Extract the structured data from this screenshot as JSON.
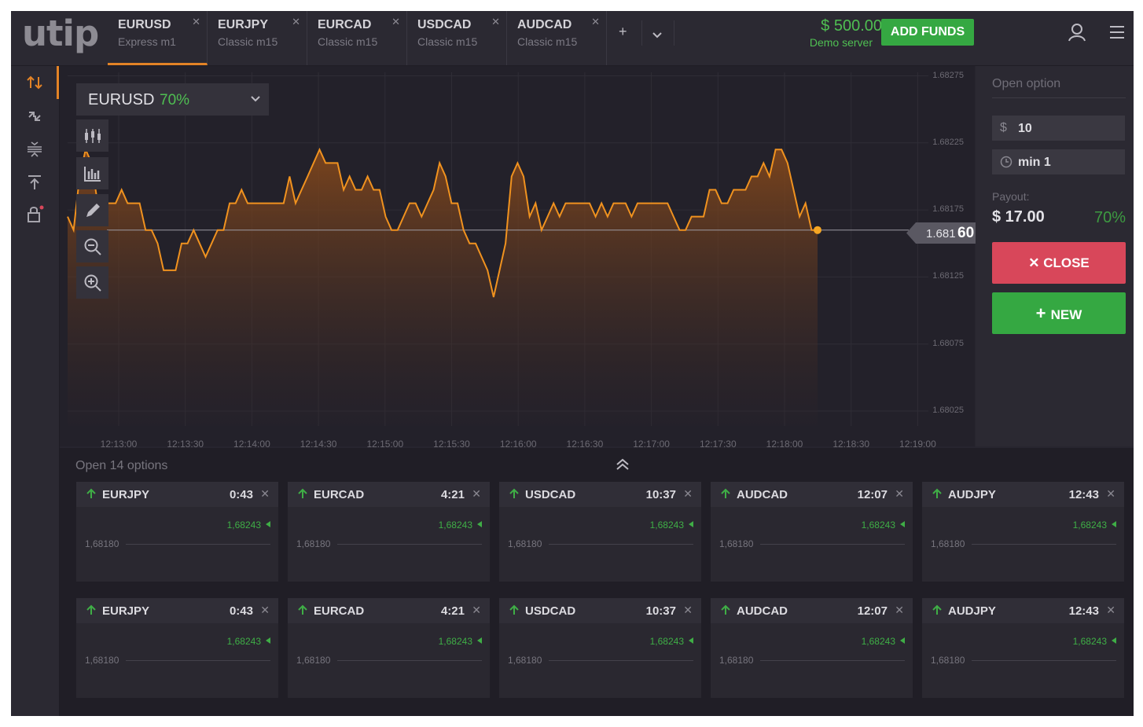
{
  "brand": {
    "logo": "utip"
  },
  "tabs": [
    {
      "symbol": "EURUSD",
      "subtitle": "Express m1",
      "active": true
    },
    {
      "symbol": "EURJPY",
      "subtitle": "Classic m15"
    },
    {
      "symbol": "EURCAD",
      "subtitle": "Classic m15"
    },
    {
      "symbol": "USDCAD",
      "subtitle": "Classic m15"
    },
    {
      "symbol": "AUDCAD",
      "subtitle": "Classic m15"
    }
  ],
  "account": {
    "balance": "$ 500.00",
    "server": "Demo server",
    "add_funds_label": "ADD FUNDS"
  },
  "chart": {
    "pair": "EURUSD",
    "payout_pct": "70%",
    "price_prefix": "1.681",
    "price_suffix": "60",
    "colors": {
      "line": "#f0921f",
      "accent_green": "#4fbf52",
      "close_red": "#d8475a"
    }
  },
  "chart_data": {
    "type": "area",
    "yticks": [
      1.68275,
      1.68225,
      1.68175,
      1.68125,
      1.68075,
      1.68025
    ],
    "yticks_text": [
      "1.68275",
      "1.68225",
      "1.68175",
      "1.68125",
      "1.68075",
      "1.68025"
    ],
    "xticks": [
      "12:13:00",
      "12:13:30",
      "12:14:00",
      "12:14:30",
      "12:15:00",
      "12:15:30",
      "12:16:00",
      "12:16:30",
      "12:17:00",
      "12:17:30",
      "12:18:00",
      "12:18:30",
      "12:19:00"
    ],
    "ylim": [
      1.68,
      1.683
    ],
    "current_price": 1.6816,
    "series": [
      {
        "values": [
          1.6817,
          1.6816,
          1.682,
          1.6822,
          1.6821,
          1.6818,
          1.6818,
          1.6818,
          1.6818,
          1.6819,
          1.6818,
          1.6818,
          1.6818,
          1.6816,
          1.6816,
          1.6815,
          1.6813,
          1.6813,
          1.6813,
          1.6815,
          1.6815,
          1.6816,
          1.6815,
          1.6814,
          1.6815,
          1.6816,
          1.6816,
          1.6818,
          1.6818,
          1.6819,
          1.6818,
          1.6818,
          1.6818,
          1.6818,
          1.6818,
          1.6818,
          1.6818,
          1.682,
          1.6818,
          1.6819,
          1.682,
          1.6821,
          1.6822,
          1.6821,
          1.6821,
          1.6821,
          1.6819,
          1.682,
          1.6819,
          1.6819,
          1.682,
          1.6819,
          1.6819,
          1.6817,
          1.6816,
          1.6816,
          1.6817,
          1.6818,
          1.6818,
          1.6817,
          1.6818,
          1.6819,
          1.6821,
          1.682,
          1.6818,
          1.6818,
          1.6816,
          1.6815,
          1.6815,
          1.6814,
          1.6813,
          1.6811,
          1.6813,
          1.6815,
          1.682,
          1.6821,
          1.682,
          1.6817,
          1.6818,
          1.6816,
          1.6817,
          1.6818,
          1.6817,
          1.6818,
          1.6818,
          1.6818,
          1.6818,
          1.6818,
          1.6817,
          1.6818,
          1.6817,
          1.6818,
          1.6818,
          1.6818,
          1.6817,
          1.6818,
          1.6818,
          1.6818,
          1.6818,
          1.6818,
          1.6818,
          1.6817,
          1.6816,
          1.6816,
          1.6817,
          1.6817,
          1.6817,
          1.6819,
          1.6819,
          1.6818,
          1.6818,
          1.6819,
          1.6819,
          1.6819,
          1.682,
          1.682,
          1.6821,
          1.682,
          1.6822,
          1.6822,
          1.6821,
          1.6819,
          1.6817,
          1.6818,
          1.6816,
          1.6816
        ]
      }
    ]
  },
  "sidebar_tools": [
    "swap-arrows-icon",
    "diagonal-arrows-icon",
    "compress-icon",
    "upload-icon",
    "lock-icon"
  ],
  "chart_tools": [
    "candles-icon",
    "bars-icon",
    "pencil-icon",
    "zoom-out-icon",
    "zoom-in-icon"
  ],
  "option_panel": {
    "title": "Open option",
    "amount": "10",
    "amount_prefix": "$",
    "duration": "min 1",
    "payout_label": "Payout:",
    "payout_value": "$ 17.00",
    "payout_pct": "70%",
    "close_label": "CLOSE",
    "new_label": "NEW"
  },
  "open_options": {
    "title": "Open 14 options",
    "cards": [
      {
        "symbol": "EURJPY",
        "time": "0:43",
        "price": "1,68243",
        "base": "1,68180"
      },
      {
        "symbol": "EURCAD",
        "time": "4:21",
        "price": "1,68243",
        "base": "1,68180"
      },
      {
        "symbol": "USDCAD",
        "time": "10:37",
        "price": "1,68243",
        "base": "1,68180"
      },
      {
        "symbol": "AUDCAD",
        "time": "12:07",
        "price": "1,68243",
        "base": "1,68180"
      },
      {
        "symbol": "AUDJPY",
        "time": "12:43",
        "price": "1,68243",
        "base": "1,68180"
      },
      {
        "symbol": "EURJPY",
        "time": "0:43",
        "price": "1,68243",
        "base": "1,68180"
      },
      {
        "symbol": "EURCAD",
        "time": "4:21",
        "price": "1,68243",
        "base": "1,68180"
      },
      {
        "symbol": "USDCAD",
        "time": "10:37",
        "price": "1,68243",
        "base": "1,68180"
      },
      {
        "symbol": "AUDCAD",
        "time": "12:07",
        "price": "1,68243",
        "base": "1,68180"
      },
      {
        "symbol": "AUDJPY",
        "time": "12:43",
        "price": "1,68243",
        "base": "1,68180"
      }
    ]
  }
}
